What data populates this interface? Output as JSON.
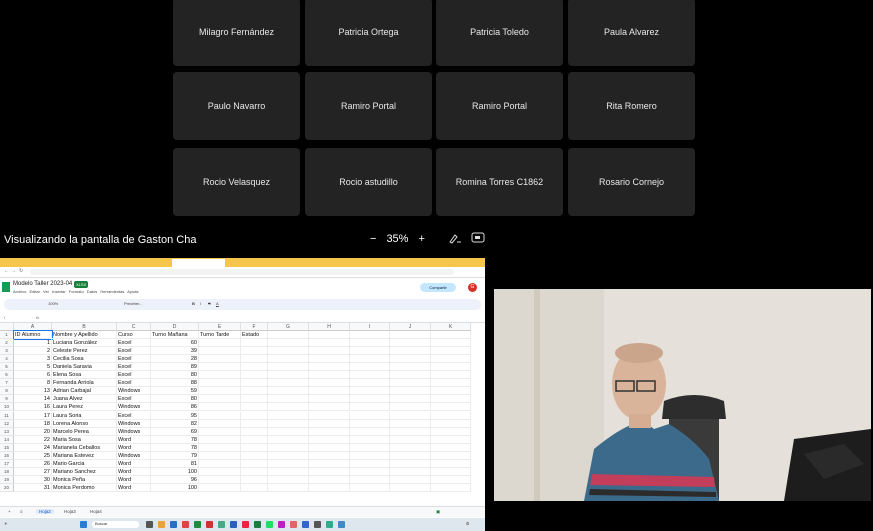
{
  "participants": [
    "Milagro Fernández",
    "Patricia Ortega",
    "Patricia Toledo",
    "Paula Alvarez",
    "Paulo Navarro",
    "Ramiro Portal",
    "Ramiro Portal",
    "Rita Romero",
    "Rocio Velasquez",
    "Rocio astudillo",
    "Romina Torres C1862",
    "Rosario Cornejo"
  ],
  "share": {
    "label": "Visualizando la pantalla de Gaston Cha",
    "zoom": "35%",
    "zoom_out": "−",
    "zoom_in": "+"
  },
  "spreadsheet": {
    "title": "Modelo Taller 2023-04",
    "menu": "Archivo Editar Ver Insertar Formato Datos Herramientas Ayuda",
    "share_btn": "Compartir",
    "zoom": "100%",
    "columns": [
      "A",
      "B",
      "C",
      "D",
      "E",
      "F",
      "G",
      "H",
      "I",
      "J",
      "K"
    ],
    "headers": [
      "ID Alumno",
      "Nombre y Apellido",
      "Curso",
      "Turno Mañana",
      "Turno Tarde",
      "Estado"
    ],
    "rows": [
      [
        "1",
        "Luciana González",
        "Excel",
        "60"
      ],
      [
        "2",
        "Celeste Perez",
        "Excel",
        "39"
      ],
      [
        "3",
        "Cecilia Sosa",
        "Excel",
        "28"
      ],
      [
        "5",
        "Daniela Saravia",
        "Excel",
        "89"
      ],
      [
        "6",
        "Elena Sosa",
        "Excel",
        "80"
      ],
      [
        "8",
        "Fernanda Arriola",
        "Excel",
        "88"
      ],
      [
        "13",
        "Adrian Carbajal",
        "Windows",
        "59"
      ],
      [
        "14",
        "Juana Alvez",
        "Excel",
        "80"
      ],
      [
        "16",
        "Laura Perez",
        "Windows",
        "86"
      ],
      [
        "17",
        "Laura Soria",
        "Excel",
        "95"
      ],
      [
        "18",
        "Lorena Alonso",
        "Windows",
        "82"
      ],
      [
        "20",
        "Marcelo Perea",
        "Windows",
        "69"
      ],
      [
        "22",
        "Maria Sosa",
        "Word",
        "78"
      ],
      [
        "24",
        "Marianela Ceballos",
        "Word",
        "78"
      ],
      [
        "25",
        "Mariana Estevez",
        "Windows",
        "79"
      ],
      [
        "26",
        "Mario Garcia",
        "Word",
        "81"
      ],
      [
        "27",
        "Mariano Sanchez",
        "Word",
        "100"
      ],
      [
        "30",
        "Monica Peña",
        "Word",
        "96"
      ],
      [
        "31",
        "Monica Perdomo",
        "Word",
        "100"
      ]
    ],
    "sheets": [
      "Hoja2",
      "Hoja3",
      "Hoja4"
    ],
    "taskbar_search": "Buscar"
  }
}
